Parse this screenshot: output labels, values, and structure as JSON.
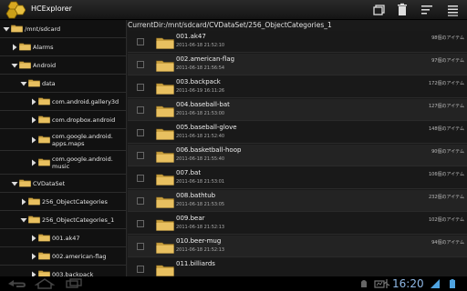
{
  "app": {
    "title": "HCExplorer"
  },
  "toolbar": {
    "icons": [
      "window-icon",
      "trash-icon",
      "sort-icon",
      "menu-icon"
    ]
  },
  "tree": {
    "items": [
      {
        "label": "/mnt/sdcard",
        "expanded": true
      },
      {
        "label": "Alarms",
        "expanded": false
      },
      {
        "label": "Android",
        "expanded": true
      },
      {
        "label": "data",
        "expanded": true
      },
      {
        "label": "com.android.gallery3d",
        "expanded": false
      },
      {
        "label": "com.dropbox.android",
        "expanded": false
      },
      {
        "label": "com.google.android.\napps.maps",
        "expanded": false
      },
      {
        "label": "com.google.android.\nmusic",
        "expanded": false
      },
      {
        "label": "CVDataSet",
        "expanded": true
      },
      {
        "label": "256_ObjectCategories",
        "expanded": false
      },
      {
        "label": "256_ObjectCategories_1",
        "expanded": true
      },
      {
        "label": "001.ak47",
        "expanded": false
      },
      {
        "label": "002.american-flag",
        "expanded": false
      },
      {
        "label": "003.backpack",
        "expanded": false
      }
    ]
  },
  "main": {
    "current_dir": "CurrentDir:/mnt/sdcard/CVDataSet/256_ObjectCategories_1",
    "files": [
      {
        "name": "001.ak47",
        "date": "2011-06-18 21:52:10",
        "count": "98個のアイテム"
      },
      {
        "name": "002.american-flag",
        "date": "2011-06-18 21:56:54",
        "count": "97個のアイテム"
      },
      {
        "name": "003.backpack",
        "date": "2011-06-19 16:11:26",
        "count": "172個のアイテム"
      },
      {
        "name": "004.baseball-bat",
        "date": "2011-06-18 21:53:00",
        "count": "127個のアイテム"
      },
      {
        "name": "005.baseball-glove",
        "date": "2011-06-18 21:52:40",
        "count": "148個のアイテム"
      },
      {
        "name": "006.basketball-hoop",
        "date": "2011-06-18 21:55:40",
        "count": "90個のアイテム"
      },
      {
        "name": "007.bat",
        "date": "2011-06-18 21:53:01",
        "count": "106個のアイテム"
      },
      {
        "name": "008.bathtub",
        "date": "2011-06-18 21:53:05",
        "count": "232個のアイテム"
      },
      {
        "name": "009.bear",
        "date": "2011-06-18 21:52:13",
        "count": "102個のアイテム"
      },
      {
        "name": "010.beer-mug",
        "date": "2011-06-18 21:52:13",
        "count": "94個のアイテム"
      },
      {
        "name": "011.billiards",
        "date": "",
        "count": ""
      }
    ]
  },
  "system": {
    "clock": "16:20"
  },
  "colors": {
    "folder": "#e8c060",
    "accent_clock": "#8fb8e6",
    "background": "#1b1b1b"
  }
}
